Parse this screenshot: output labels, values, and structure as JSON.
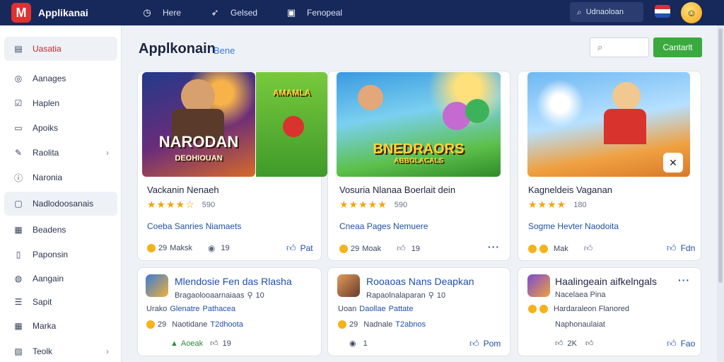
{
  "topbar": {
    "logo_letter": "M",
    "app_name": "Applikanai",
    "nav": [
      {
        "label": "Here",
        "icon": "clock-icon"
      },
      {
        "label": "Gelsed",
        "icon": "rocket-icon"
      },
      {
        "label": "Fenopeal",
        "icon": "message-icon"
      }
    ],
    "search_label": "Udnaoloan",
    "brand_color": "#17285a"
  },
  "sidebar": {
    "items": [
      {
        "label": "Uasatia",
        "icon": "store-icon"
      },
      {
        "label": "Aanages",
        "icon": "target-icon"
      },
      {
        "label": "Haplen",
        "icon": "checkbox-icon"
      },
      {
        "label": "Apoiks",
        "icon": "window-icon"
      },
      {
        "label": "Raolita",
        "icon": "edit-icon"
      },
      {
        "label": "Naronia",
        "icon": "info-icon"
      },
      {
        "label": "Nadlodoosanais",
        "icon": "card-icon"
      },
      {
        "label": "Beadens",
        "icon": "grid-icon"
      },
      {
        "label": "Paponsin",
        "icon": "document-icon"
      },
      {
        "label": "Aangain",
        "icon": "globe-icon"
      },
      {
        "label": "Sapit",
        "icon": "list-icon"
      },
      {
        "label": "Marka",
        "icon": "calendar-icon"
      },
      {
        "label": "Teolk",
        "icon": "image-icon"
      }
    ]
  },
  "main": {
    "title": "Applkonain",
    "subtitle": "Bene",
    "search_icon": "search-icon",
    "action_label": "Cantarlt",
    "accent": "#3aa93e"
  },
  "featured": [
    {
      "thumb_title": "NARODAN",
      "thumb_subtitle": "DEOHIOUAN",
      "side_thumb_title": "AMAMLA",
      "name": "Vackanin Nenaeh",
      "stars": "★★★★☆",
      "rating_value": "590",
      "link": "Coeba Sanries Niamaets",
      "coins": "29",
      "coin_label": "Maksk",
      "count": "19",
      "like_label": "Pat"
    },
    {
      "thumb_title": "BNEDRAORS",
      "thumb_subtitle": "ABBOLACALS",
      "name": "Vosuria Nlanaa Boerlait dein",
      "stars": "★★★★★",
      "rating_value": "590",
      "link": "Cneaa Pages Nemuere",
      "coins": "29",
      "coin_label": "Moak",
      "count": "19"
    },
    {
      "name": "Kagneldeis Vaganan",
      "stars": "★★★★",
      "rating_value": "180",
      "link": "Sogme Hevter Naodoita",
      "coin_label": "Mak",
      "like_label": "Fdn"
    }
  ],
  "apps": [
    {
      "title": "Mlendosie Fen das Rlasha",
      "line1": "Bragaolooaarnaiaas",
      "line1_count": "10",
      "line2_prefix": "Urako",
      "line2_green": "Glenatre",
      "line2_blue": "Pathacea",
      "line3_coins": "29",
      "line3_label": "Naotidane",
      "line3_blue": "T2dhoota",
      "badge": "Aoeak",
      "count": "19"
    },
    {
      "title": "Rooaoas Nans Deapkan",
      "line1": "Rapaolnalaparan",
      "line1_count": "10",
      "line2_prefix": "Uoan",
      "line2_green": "Daollae",
      "line2_blue": "Pattate",
      "line3_coins": "29",
      "line3_label": "Nadnale",
      "line3_blue": "T2abnos",
      "count": "1",
      "like_label": "Pom"
    },
    {
      "title": "Haalingeain aifkelngals",
      "line1": "Nacelaea Pina",
      "line2": "Hardaraleon Flanored",
      "line3": "Naphonaulaiat",
      "count": "2K",
      "like_label": "Fao"
    }
  ]
}
